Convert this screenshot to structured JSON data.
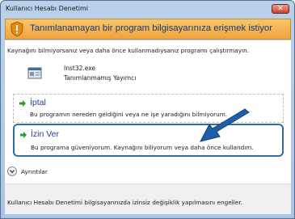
{
  "window": {
    "title": "Kullanıcı Hesabı Denetimi",
    "close_symbol": "✕"
  },
  "banner": {
    "text": "Tanımlanamayan bir program bilgisayarınıza erişmek istiyor"
  },
  "intro": "Kaynağını bilmiyorsanız veya daha önce kullanmadıysanız programı çalıştırmayın.",
  "program": {
    "name": "Inst32.exe",
    "publisher": "Tanımlanmamış Yayımcı"
  },
  "options": {
    "cancel": {
      "title": "İptal",
      "desc": "Bu programın nereden geldiğini veya ne işe yaradığını bilmiyorum."
    },
    "allow": {
      "title": "İzin Ver",
      "desc": "Bu programa güveniyorum. Kaynağını biliyorum veya daha önce kullandım."
    }
  },
  "details": {
    "label": "Ayrıntılar"
  },
  "footer": {
    "text": "Kullanıcı Hesabı Denetimi bilgisayarınızda izinsiz değişiklik yapılmasını engeller."
  },
  "colors": {
    "accent": "#1e3f94",
    "highlight_border": "#2f6da5",
    "banner": "#f0a33d"
  }
}
